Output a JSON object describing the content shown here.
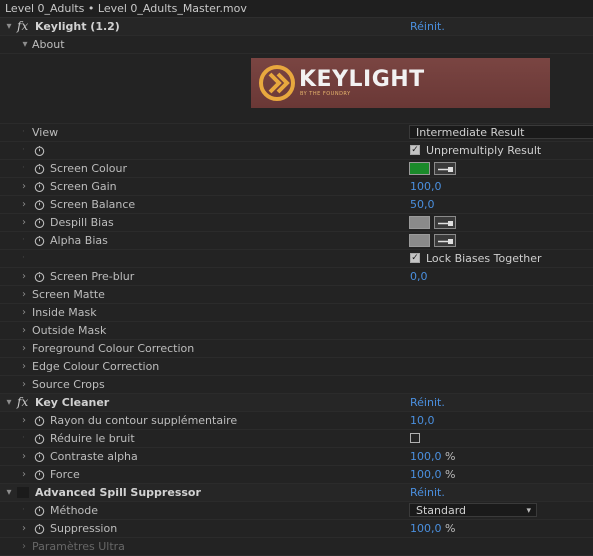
{
  "window": {
    "title": "Level 0_Adults • Level 0_Adults_Master.mov"
  },
  "effects": {
    "keylight": {
      "name": "Keylight (1.2)",
      "reset": "Réinit.",
      "about": "About",
      "banner_title": "KEYLIGHT",
      "banner_sub": "BY THE FOUNDRY",
      "banner_colors": {
        "bg": "#6d3a38",
        "logo": "#e8a83e"
      },
      "view": {
        "label": "View",
        "value": "Intermediate Result"
      },
      "unpremultiply": {
        "label": "Unpremultiply Result",
        "checked": true
      },
      "screen_colour": {
        "label": "Screen Colour",
        "color": "#1a8a2a"
      },
      "screen_gain": {
        "label": "Screen Gain",
        "value": "100,0"
      },
      "screen_balance": {
        "label": "Screen Balance",
        "value": "50,0"
      },
      "despill_bias": {
        "label": "Despill Bias",
        "color": "#8a8a8a"
      },
      "alpha_bias": {
        "label": "Alpha Bias",
        "color": "#8a8a8a"
      },
      "lock_biases": {
        "label": "Lock Biases Together",
        "checked": true
      },
      "screen_preblur": {
        "label": "Screen Pre-blur",
        "value": "0,0"
      },
      "groups": [
        "Screen Matte",
        "Inside Mask",
        "Outside Mask",
        "Foreground Colour Correction",
        "Edge Colour Correction",
        "Source Crops"
      ]
    },
    "key_cleaner": {
      "name": "Key Cleaner",
      "reset": "Réinit.",
      "rayon": {
        "label": "Rayon du contour supplémentaire",
        "value": "10,0"
      },
      "reduire": {
        "label": "Réduire le bruit",
        "checked": false
      },
      "contraste": {
        "label": "Contraste alpha",
        "value": "100,0",
        "unit": "%"
      },
      "force": {
        "label": "Force",
        "value": "100,0",
        "unit": "%"
      }
    },
    "spill": {
      "name": "Advanced Spill Suppressor",
      "reset": "Réinit.",
      "methode": {
        "label": "Méthode",
        "value": "Standard"
      },
      "suppression": {
        "label": "Suppression",
        "value": "100,0",
        "unit": "%"
      },
      "ultra": {
        "label": "Paramètres Ultra"
      }
    }
  },
  "icons": {
    "twirl_open": "▾",
    "twirl_closed": "›",
    "check": "✓",
    "caret": "▾"
  }
}
